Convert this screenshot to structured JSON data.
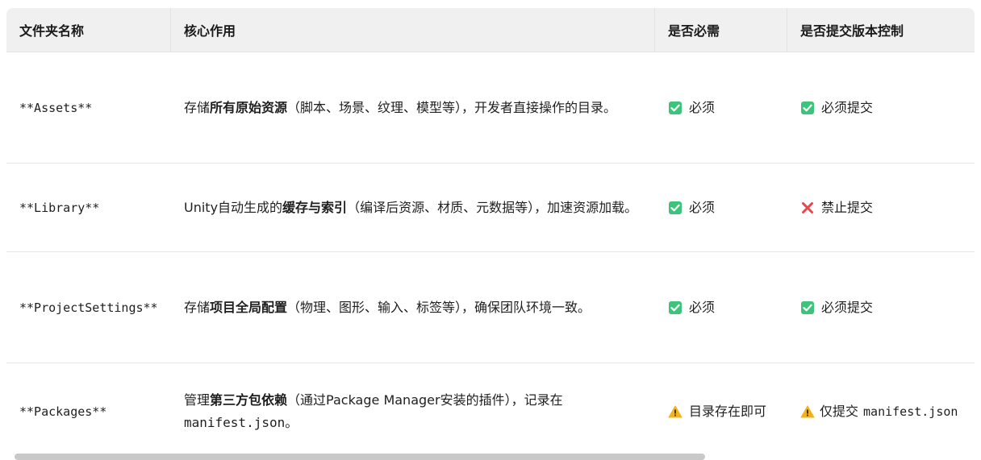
{
  "table": {
    "headers": [
      "文件夹名称",
      "核心作用",
      "是否必需",
      "是否提交版本控制"
    ],
    "rows": [
      {
        "name": "**Assets**",
        "desc_before": "存储",
        "desc_bold": "所有原始资源",
        "desc_after": "（脚本、场景、纹理、模型等），开发者直接操作的目录。",
        "desc_code": "",
        "desc_end": "",
        "required_icon": "check-icon",
        "required": "必须",
        "vc_icon": "check-icon",
        "vc": "必须提交",
        "vc_code": ""
      },
      {
        "name": "**Library**",
        "desc_before": "Unity自动生成的",
        "desc_bold": "缓存与索引",
        "desc_after": "（编译后资源、材质、元数据等），加速资源加载。",
        "desc_code": "",
        "desc_end": "",
        "required_icon": "check-icon",
        "required": "必须",
        "vc_icon": "cross-icon",
        "vc": "禁止提交",
        "vc_code": ""
      },
      {
        "name": "**ProjectSettings**",
        "desc_before": "存储",
        "desc_bold": "项目全局配置",
        "desc_after": "（物理、图形、输入、标签等），确保团队环境一致。",
        "desc_code": "",
        "desc_end": "",
        "required_icon": "check-icon",
        "required": "必须",
        "vc_icon": "check-icon",
        "vc": "必须提交",
        "vc_code": ""
      },
      {
        "name": "**Packages**",
        "desc_before": "管理",
        "desc_bold": "第三方包依赖",
        "desc_after": "（通过Package Manager安装的插件），记录在",
        "desc_code": "manifest.json",
        "desc_end": "。",
        "required_icon": "warning-icon",
        "required": "目录存在即可",
        "vc_icon": "warning-icon",
        "vc": "仅提交",
        "vc_code": "manifest.json"
      }
    ]
  },
  "colors": {
    "check": "#3ec47a",
    "cross": "#e8474f",
    "warning": "#f2b21b",
    "header_bg": "#f0f0f0"
  }
}
